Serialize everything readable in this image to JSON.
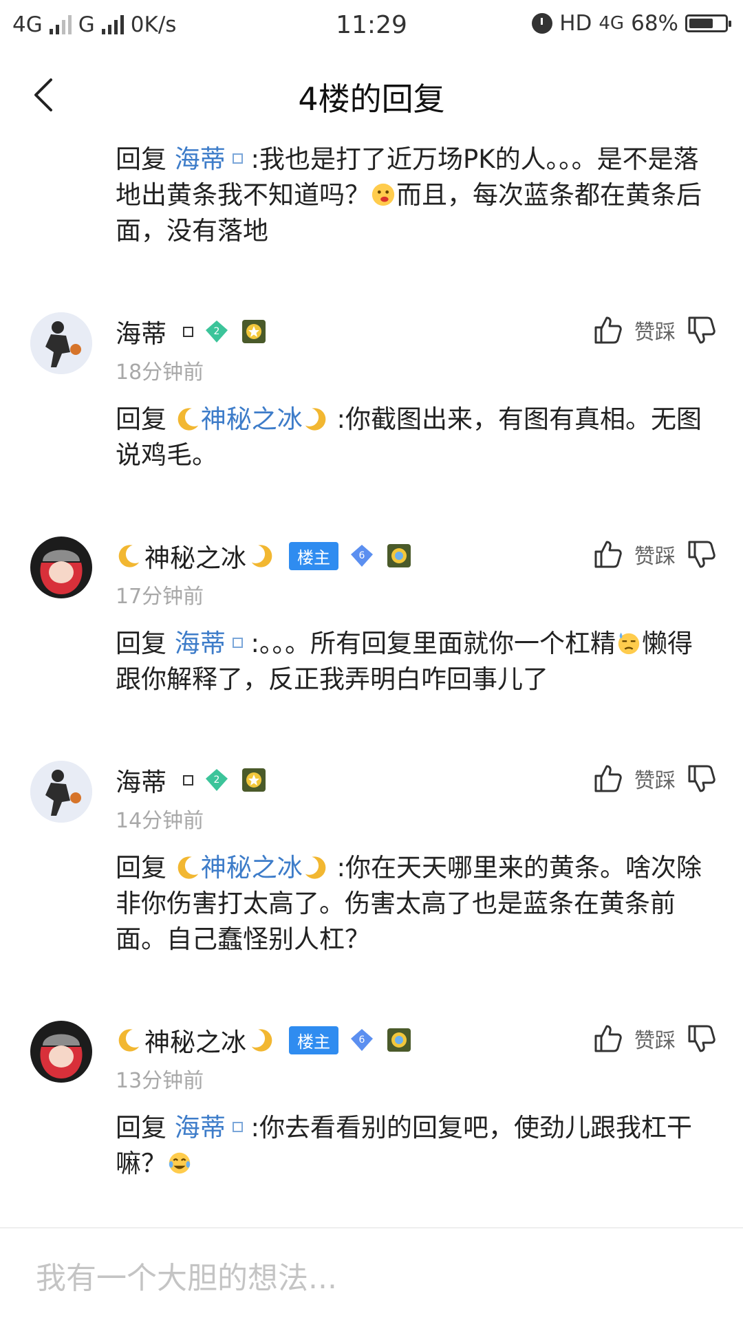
{
  "status_bar": {
    "net1": "4G",
    "net2": "G",
    "speed": "0K/s",
    "time": "11:29",
    "hd": "HD",
    "net3": "4G",
    "battery_text": "68%",
    "battery_level": 0.68
  },
  "header": {
    "title": "4楼的回复"
  },
  "top_reply": {
    "prefix": "回复 ",
    "mention": "海蒂",
    "text_a": " :我也是打了近万场PK的人。。。是不是落地出黄条我不知道吗？",
    "text_b": "而且，每次蓝条都在黄条后面，没有落地"
  },
  "actions": {
    "label": "赞踩"
  },
  "comments": [
    {
      "username": "海蒂",
      "level": "2",
      "time": "18分钟前",
      "reply_prefix": "回复 ",
      "mention": "神秘之冰",
      "text": " :你截图出来，有图有真相。无图说鸡毛。"
    },
    {
      "username": "神秘之冰",
      "host_badge": "楼主",
      "level": "6",
      "time": "17分钟前",
      "reply_prefix": "回复 ",
      "mention": "海蒂",
      "text_a": " :。。。所有回复里面就你一个杠精",
      "text_b": "懒得跟你解释了，反正我弄明白咋回事儿了"
    },
    {
      "username": "海蒂",
      "level": "2",
      "time": "14分钟前",
      "reply_prefix": "回复 ",
      "mention": "神秘之冰",
      "text": " :你在天天哪里来的黄条。啥次除非你伤害打太高了。伤害太高了也是蓝条在黄条前面。自己蠢怪别人杠？"
    },
    {
      "username": "神秘之冰",
      "host_badge": "楼主",
      "level": "6",
      "time": "13分钟前",
      "reply_prefix": "回复 ",
      "mention": "海蒂",
      "text_a": " :你去看看别的回复吧，使劲儿跟我杠干嘛？"
    }
  ],
  "input": {
    "placeholder": "我有一个大胆的想法..."
  },
  "colors": {
    "mention": "#3d7cc9",
    "host_badge": "#2f8cf0",
    "timestamp": "#a8a8a8"
  }
}
